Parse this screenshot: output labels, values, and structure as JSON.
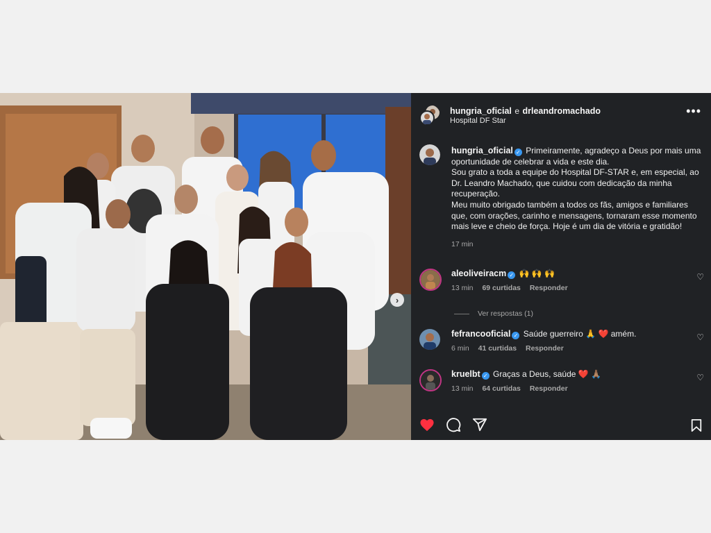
{
  "post_header": {
    "author": "hungria_oficial",
    "joiner": "e",
    "coauthor": "drleandromachado",
    "location": "Hospital DF Star",
    "more_icon": "more-options-icon"
  },
  "caption": {
    "username": "hungria_oficial",
    "lines": [
      "Primeiramente, agradeço a Deus por mais uma oportunidade de celebrar a vida e este dia.",
      "Sou grato a toda a equipe do Hospital DF-STAR e, em especial, ao Dr. Leandro Machado, que cuidou com dedicação da minha recuperação.",
      "Meu muito obrigado também a todos os fãs, amigos e familiares que, com orações, carinho e mensagens, tornaram esse momento mais leve e cheio de força. Hoje é um dia de vitória e gratidão!"
    ],
    "time": "17 min"
  },
  "comments": [
    {
      "username": "aleoliveiracm",
      "text": "🙌 🙌 🙌",
      "time": "13 min",
      "likes": "69 curtidas",
      "reply": "Responder"
    },
    {
      "username": "fefrancooficial",
      "text": "Saúde guerreiro 🙏 ❤️ amém.",
      "time": "6 min",
      "likes": "41 curtidas",
      "reply": "Responder"
    },
    {
      "username": "kruelbt",
      "text": "Graças a Deus, saúde ❤️ 🙏🏽",
      "time": "13 min",
      "likes": "64 curtidas",
      "reply": "Responder"
    }
  ],
  "view_replies": "Ver respostas (1)",
  "colors": {
    "panel_bg": "#202225",
    "like_red": "#ff3040",
    "verified_blue": "#3897f0",
    "page_bg": "#f1f1f1"
  },
  "icons": [
    "heart-icon",
    "comment-icon",
    "share-icon",
    "bookmark-icon",
    "next-image-icon",
    "verified-badge-icon"
  ]
}
